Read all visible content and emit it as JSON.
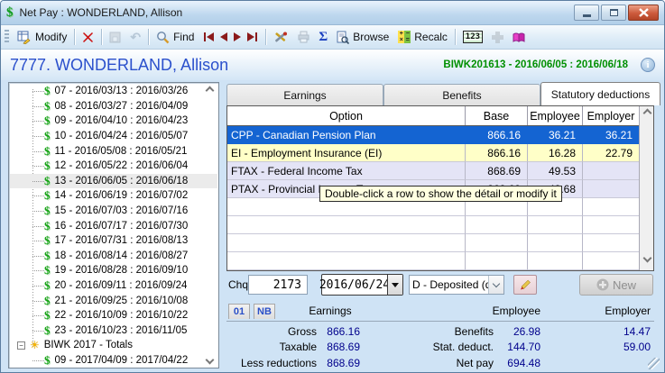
{
  "window": {
    "title": "Net Pay : WONDERLAND, Allison"
  },
  "toolbar": {
    "modify_label": "Modify",
    "find_label": "Find",
    "browse_label": "Browse",
    "recalc_label": "Recalc"
  },
  "header": {
    "employee": "7777. WONDERLAND, Allison",
    "period": "BIWK201613 - 2016/06/05 : 2016/06/18"
  },
  "icons": {
    "app_logo": "$",
    "dollar": "$",
    "sun": "☀",
    "collapse": "−",
    "undo": "↶",
    "sigma": "Σ",
    "calc": "123",
    "info": "i",
    "recalc": [
      "+",
      "−",
      "×",
      "="
    ]
  },
  "tree": {
    "selected_index": 6,
    "items": [
      {
        "label": "07 - 2016/03/13 : 2016/03/26",
        "type": "pay"
      },
      {
        "label": "08 - 2016/03/27 : 2016/04/09",
        "type": "pay"
      },
      {
        "label": "09 - 2016/04/10 : 2016/04/23",
        "type": "pay"
      },
      {
        "label": "10 - 2016/04/24 : 2016/05/07",
        "type": "pay"
      },
      {
        "label": "11 - 2016/05/08 : 2016/05/21",
        "type": "pay"
      },
      {
        "label": "12 - 2016/05/22 : 2016/06/04",
        "type": "pay"
      },
      {
        "label": "13 - 2016/06/05 : 2016/06/18",
        "type": "pay"
      },
      {
        "label": "14 - 2016/06/19 : 2016/07/02",
        "type": "pay"
      },
      {
        "label": "15 - 2016/07/03 : 2016/07/16",
        "type": "pay"
      },
      {
        "label": "16 - 2016/07/17 : 2016/07/30",
        "type": "pay"
      },
      {
        "label": "17 - 2016/07/31 : 2016/08/13",
        "type": "pay"
      },
      {
        "label": "18 - 2016/08/14 : 2016/08/27",
        "type": "pay"
      },
      {
        "label": "19 - 2016/08/28 : 2016/09/10",
        "type": "pay"
      },
      {
        "label": "20 - 2016/09/11 : 2016/09/24",
        "type": "pay"
      },
      {
        "label": "21 - 2016/09/25 : 2016/10/08",
        "type": "pay"
      },
      {
        "label": "22 - 2016/10/09 : 2016/10/22",
        "type": "pay"
      },
      {
        "label": "23 - 2016/10/23 : 2016/11/05",
        "type": "pay"
      },
      {
        "label": "BIWK 2017 - Totals",
        "type": "totals"
      },
      {
        "label": "09 - 2017/04/09 : 2017/04/22",
        "type": "pay"
      }
    ]
  },
  "tabs": [
    "Earnings",
    "Benefits",
    "Statutory deductions"
  ],
  "active_tab": 2,
  "table": {
    "columns": [
      "Option",
      "Base",
      "Employee",
      "Employer"
    ],
    "rows": [
      {
        "option": "CPP - Canadian Pension Plan",
        "base": "866.16",
        "employee": "36.21",
        "employer": "36.21",
        "state": "selected"
      },
      {
        "option": "EI - Employment Insurance (EI)",
        "base": "866.16",
        "employee": "16.28",
        "employer": "22.79",
        "state": "hover"
      },
      {
        "option": "FTAX - Federal Income Tax",
        "base": "868.69",
        "employee": "49.53",
        "employer": "",
        "state": "alt"
      },
      {
        "option": "PTAX - Provincial Income Tax",
        "base": "868.69",
        "employee": "42.68",
        "employer": "",
        "state": "alt"
      }
    ],
    "empty_row_count": 4,
    "tooltip": "Double-click a row to show the détail or modify it"
  },
  "cheque": {
    "label": "Chq",
    "number": "2173",
    "date": "2016/06/24",
    "deposit": "D - Deposited (dire",
    "new_label": "New"
  },
  "summary": {
    "badges": [
      "01",
      "NB"
    ],
    "columns": [
      "Earnings",
      "Employee",
      "Employer"
    ],
    "rows": [
      {
        "label1": "Gross",
        "value1": "866.16",
        "label2": "Benefits",
        "value2": "26.98",
        "value3": "14.47"
      },
      {
        "label1": "Taxable",
        "value1": "868.69",
        "label2": "Stat. deduct.",
        "value2": "144.70",
        "value3": "59.00"
      },
      {
        "label1": "Less reductions",
        "value1": "868.69",
        "label2": "Net pay",
        "value2": "694.48",
        "value3": ""
      }
    ]
  },
  "colors": {
    "title_blue": "#2b50cc",
    "period_green": "#008f00",
    "selected_row": "#1464d2",
    "row_highlight": "#ffffc8",
    "row_alt": "#e4e4f6",
    "value_navy": "#00008c"
  }
}
